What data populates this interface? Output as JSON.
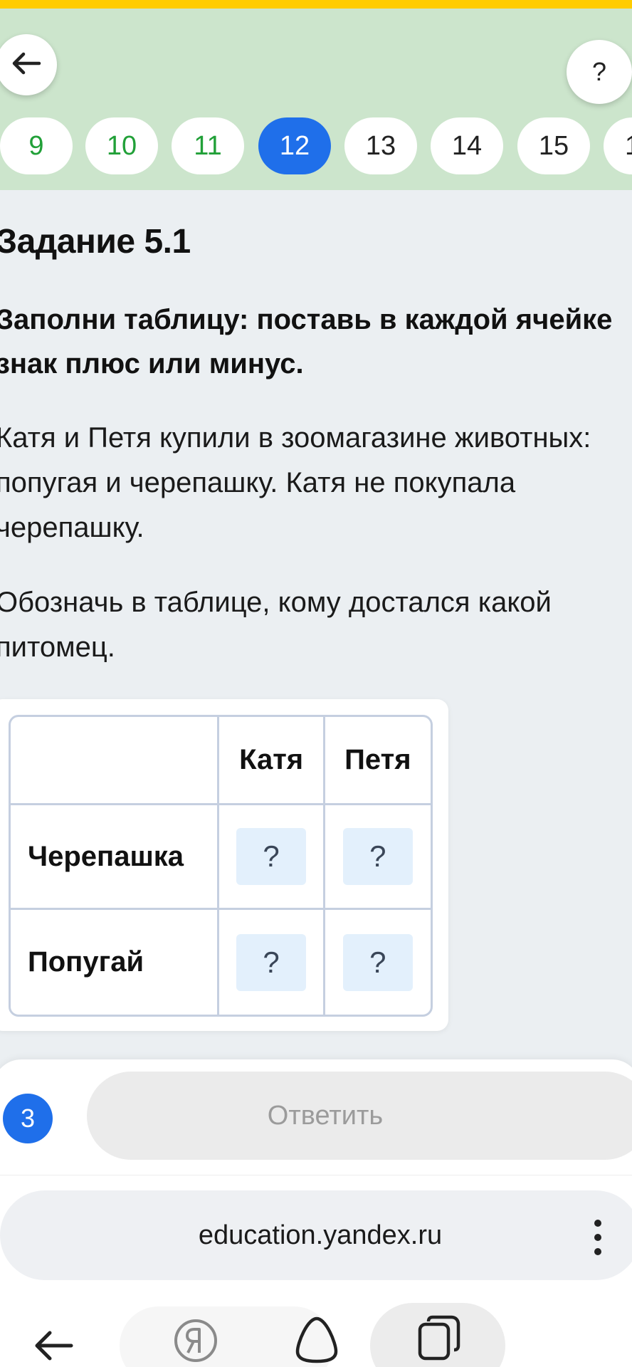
{
  "header": {
    "back_icon": "arrow-left-icon",
    "help_label": "?",
    "tasks": [
      {
        "label": "9",
        "state": "done"
      },
      {
        "label": "10",
        "state": "done"
      },
      {
        "label": "11",
        "state": "done"
      },
      {
        "label": "12",
        "state": "active"
      },
      {
        "label": "13",
        "state": "todo"
      },
      {
        "label": "14",
        "state": "todo"
      },
      {
        "label": "15",
        "state": "todo"
      },
      {
        "label": "1",
        "state": "todo"
      }
    ]
  },
  "task": {
    "title": "Задание 5.1",
    "instruction": "Заполни таблицу: поставь в каждой ячейке знак плюс или минус.",
    "paragraph1": "Катя и Петя купили в зоомагазине животных: попугая и черепашку. Катя не покупала черепашку.",
    "paragraph2": "Обозначь в таблице, кому достался какой питомец."
  },
  "table": {
    "columns": [
      "",
      "Катя",
      "Петя"
    ],
    "rows": [
      {
        "label": "Черепашка",
        "cells": [
          "?",
          "?"
        ]
      },
      {
        "label": "Попугай",
        "cells": [
          "?",
          "?"
        ]
      }
    ]
  },
  "footer": {
    "attempts": "3",
    "submit_label": "Ответить"
  },
  "browser": {
    "url": "education.yandex.ru"
  },
  "colors": {
    "accent_blue": "#1f6fea",
    "done_green": "#21a038",
    "header_green": "#cce5cc",
    "top_strip_yellow": "#ffcc00"
  }
}
